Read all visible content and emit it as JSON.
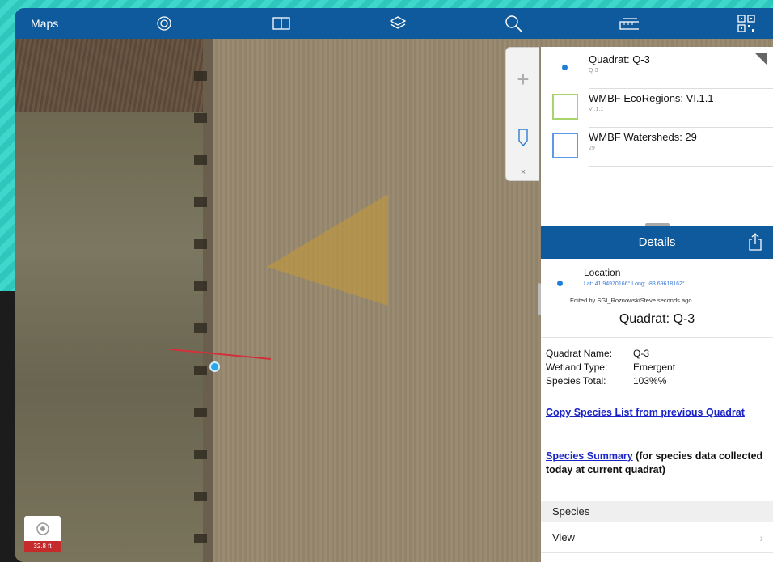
{
  "topbar": {
    "title": "Maps",
    "icons": [
      "target-icon",
      "book-icon",
      "layers-icon",
      "search-icon",
      "measure-icon",
      "qr-code-icon"
    ]
  },
  "map": {
    "scale_label": "32.8 ft"
  },
  "tools": {
    "plus_label": "+",
    "close_label": "×"
  },
  "layers": [
    {
      "title": "Quadrat: Q-3",
      "sub": "Q-3",
      "symbol": "dot",
      "color": "#1f7fd6"
    },
    {
      "title": "WMBF EcoRegions: VI.1.1",
      "sub": "VI.1.1",
      "symbol": "square",
      "color": "#a9d46b"
    },
    {
      "title": "WMBF Watersheds: 29",
      "sub": "29",
      "symbol": "square",
      "color": "#5b9ae6"
    }
  ],
  "details": {
    "header": "Details",
    "location_title": "Location",
    "location_coords": "Lat: 41.94970166° Long: -83.69618162°",
    "edited": "Edited by SGI_RoznowskiSteve seconds ago",
    "heading": "Quadrat: Q-3",
    "attributes": [
      {
        "key": "Quadrat Name:",
        "value": "Q-3"
      },
      {
        "key": "Wetland Type:",
        "value": "Emergent"
      },
      {
        "key": "Species Total:",
        "value": "103%%"
      }
    ],
    "copy_link": "Copy Species List from previous Quadrat",
    "summary_link": "Species Summary",
    "summary_rest": " (for species data collected today at current quadrat)",
    "section": "Species",
    "view_label": "View",
    "view_chevron": "›"
  },
  "colors": {
    "accent": "#0f5a9c",
    "link": "#1a23c7",
    "scale_badge": "#c62b2b"
  }
}
